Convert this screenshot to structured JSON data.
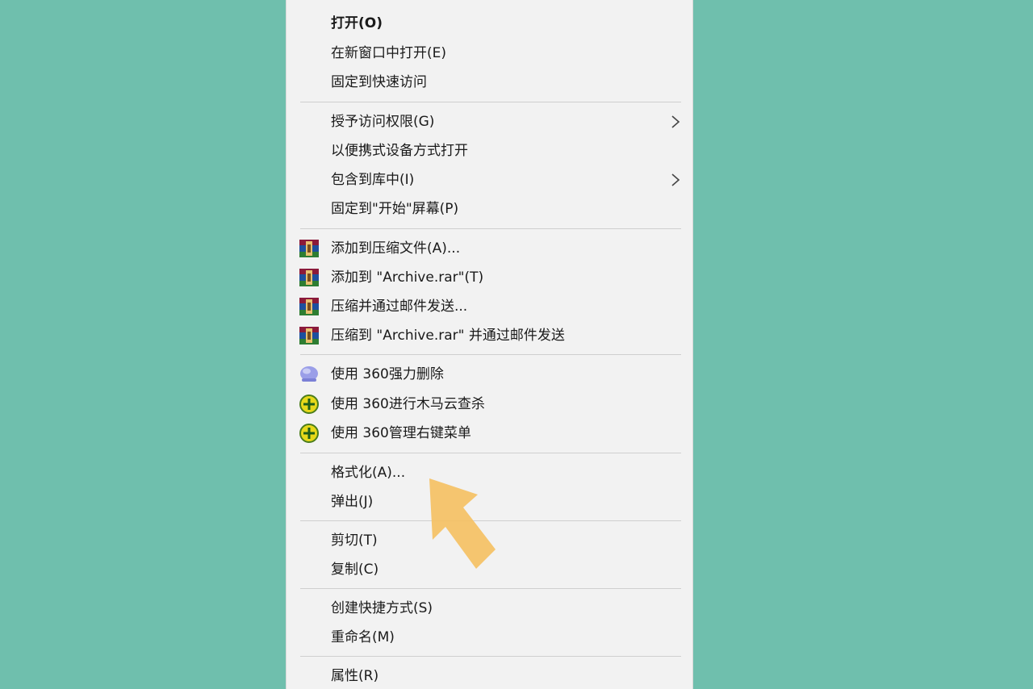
{
  "menu": {
    "items": [
      {
        "label": "打开(O)"
      },
      {
        "label": "在新窗口中打开(E)"
      },
      {
        "label": "固定到快速访问"
      },
      {
        "label": "授予访问权限(G)"
      },
      {
        "label": "以便携式设备方式打开"
      },
      {
        "label": "包含到库中(I)"
      },
      {
        "label": "固定到\"开始\"屏幕(P)"
      },
      {
        "label": "添加到压缩文件(A)..."
      },
      {
        "label": "添加到 \"Archive.rar\"(T)"
      },
      {
        "label": "压缩并通过邮件发送..."
      },
      {
        "label": "压缩到 \"Archive.rar\" 并通过邮件发送"
      },
      {
        "label": "使用 360强力删除"
      },
      {
        "label": "使用 360进行木马云查杀"
      },
      {
        "label": "使用 360管理右键菜单"
      },
      {
        "label": "格式化(A)..."
      },
      {
        "label": "弹出(J)"
      },
      {
        "label": "剪切(T)"
      },
      {
        "label": "复制(C)"
      },
      {
        "label": "创建快捷方式(S)"
      },
      {
        "label": "重命名(M)"
      },
      {
        "label": "属性(R)"
      }
    ]
  },
  "icons": {
    "winrar": "winrar-archive-icon",
    "shred": "360-shred-icon",
    "scan": "360-scan-icon",
    "manage": "360-manage-icon",
    "submenu": "chevron-right-icon",
    "pointer": "pointer-arrow-icon"
  },
  "colors": {
    "background": "#6fbfad",
    "menu": "#f2f2f2",
    "separator": "#cfcfcf",
    "arrow": "#f5c060"
  }
}
